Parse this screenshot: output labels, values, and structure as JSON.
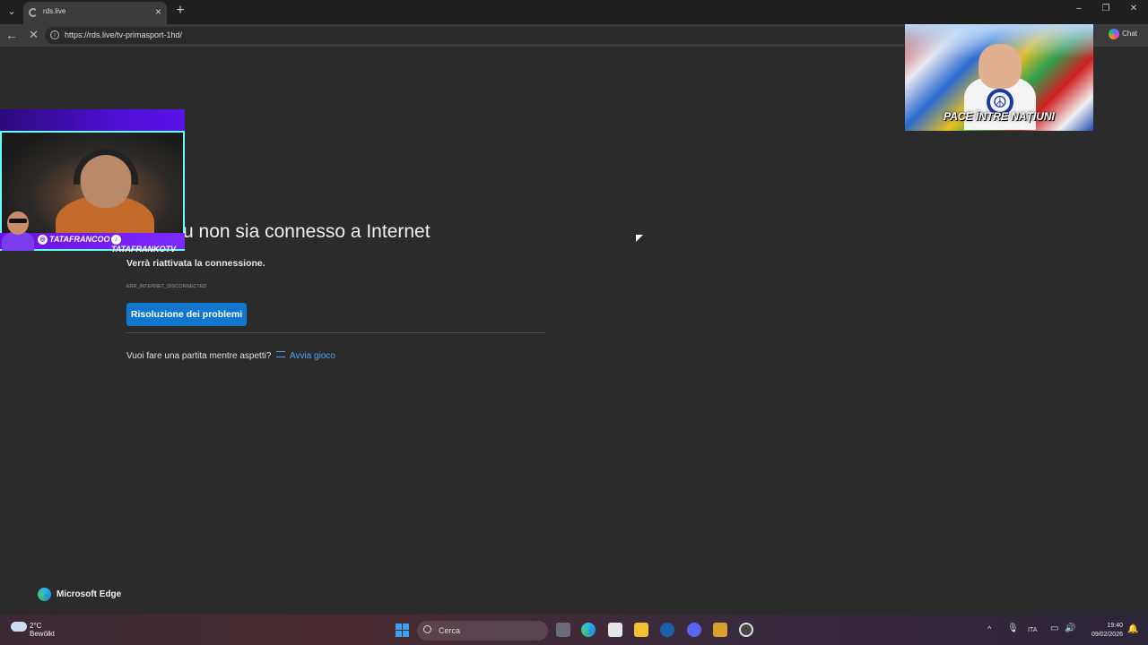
{
  "browser": {
    "tab_title": "rds.live",
    "tab_menu_icon": "chevron-down-icon",
    "new_tab_label": "+",
    "url": "https://rds.live/tv-primasport-1hd/",
    "chat_label": "Chat",
    "window_controls": {
      "minimize": "–",
      "restore": "❐",
      "close": "✕"
    }
  },
  "error_page": {
    "title": "a che tu non sia connesso a Internet",
    "subtitle": "Verrà riattivata la connessione.",
    "code": "ERR_INTERNET_DISCONNECTED",
    "fix_button": "Risoluzione dei problemi",
    "game_question": "Vuoi fare una partita mentre aspetti?",
    "game_link": "Avvia gioco",
    "brand": "Microsoft Edge"
  },
  "overlay": {
    "instagram_handle": "TATAFRANCOO",
    "tiktok_handle": "TATAFRANKOTV",
    "promo_text": "PACE ÎNTRE NAȚIUNI"
  },
  "taskbar": {
    "weather_temp": "2°C",
    "weather_desc": "Bewölkt",
    "search_placeholder": "Cerca",
    "language": "ITA",
    "time": "19:40",
    "date": "09/02/2026",
    "apps": [
      "task-view-icon",
      "edge-icon",
      "store-icon",
      "file-explorer-icon",
      "steam-icon",
      "discord-icon",
      "app-icon",
      "obs-icon"
    ]
  },
  "colors": {
    "accent": "#1177cc",
    "link": "#4da3ff",
    "page_bg": "#2b2b2b"
  }
}
